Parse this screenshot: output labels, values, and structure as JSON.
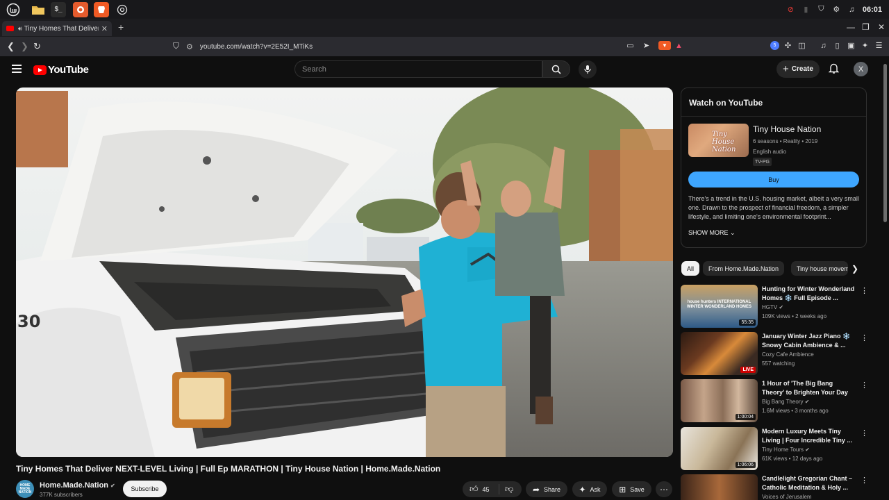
{
  "taskbar": {
    "time": "06:01",
    "apps": [
      "mint-menu-icon",
      "files-icon",
      "terminal-icon",
      "firefox-icon",
      "brave-icon",
      "browser-icon"
    ]
  },
  "browser": {
    "tab_title": "Tiny Homes That Deliver NEXT-LEVEL Living | Full Ep MARATHON | Tiny House Nation",
    "url": "youtube.com/watch?v=2E52I_MTiKs",
    "ext_badge": "5"
  },
  "youtube": {
    "logo": "YouTube",
    "search_placeholder": "Search",
    "create_label": "Create",
    "avatar_letter": "X"
  },
  "video": {
    "title": "Tiny Homes That Deliver NEXT-LEVEL Living | Full Ep MARATHON | Tiny House Nation | Home.Made.Nation",
    "channel": "Home.Made.Nation",
    "channel_avatar_text": "HOME MADE NATION",
    "subscribers": "377K subscribers",
    "subscribe_label": "Subscribe",
    "likes": "45",
    "share_label": "Share",
    "ask_label": "Ask",
    "save_label": "Save"
  },
  "panel": {
    "heading": "Watch on YouTube",
    "show_title": "Tiny House Nation",
    "thumb_logo": "Tiny House Nation",
    "meta1": "6 seasons • Reality • 2019",
    "meta2": "English audio",
    "rating": "TV-PG",
    "buy_label": "Buy",
    "description": "There's a trend in the U.S. housing market, albeit a very small one. Drawn to the prospect of financial freedom, a simpler lifestyle, and limiting one's environmental footprint...",
    "show_more": "SHOW MORE"
  },
  "chips": [
    "All",
    "From Home.Made.Nation",
    "Tiny house movement"
  ],
  "recommendations": [
    {
      "title": "Hunting for Winter Wonderland Homes ❄️ Full Episode ...",
      "channel": "HGTV",
      "stats": "109K views • 2 weeks ago",
      "badge": "55:35",
      "thumb_text": "house hunters INTERNATIONAL WINTER WONDERLAND HOMES"
    },
    {
      "title": "January Winter Jazz Piano ❄️ Snowy Cabin Ambience & ...",
      "channel": "Cozy Cafe Ambience",
      "stats": "557 watching",
      "badge": "LIVE"
    },
    {
      "title": "1 Hour of 'The Big Bang Theory' to Brighten Your Day",
      "channel": "Big Bang Theory",
      "stats": "1.6M views • 3 months ago",
      "badge": "1:00:04"
    },
    {
      "title": "Modern Luxury Meets Tiny Living | Four Incredible Tiny ...",
      "channel": "Tiny Home Tours",
      "stats": "61K views • 12 days ago",
      "badge": "1:06:06"
    },
    {
      "title": "Candlelight Gregorian Chant – Catholic Meditation & Holy ...",
      "channel": "Voices of Jerusalem",
      "stats": "",
      "badge": ""
    }
  ]
}
